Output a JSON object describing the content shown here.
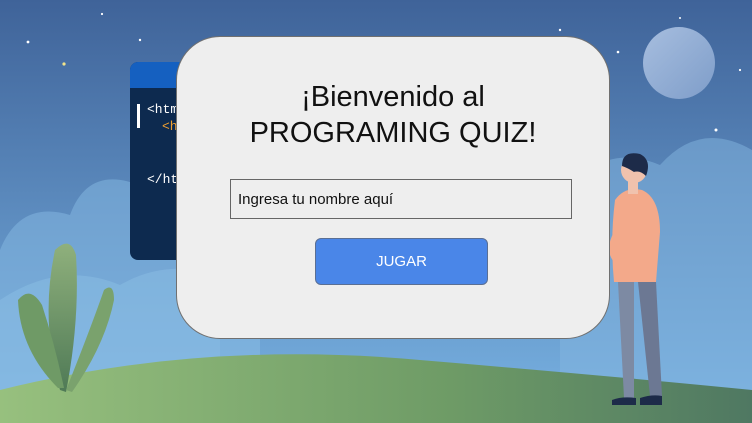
{
  "dialog": {
    "title_line1": "¡Bienvenido al",
    "title_line2": "PROGRAMING QUIZ!"
  },
  "name_input": {
    "placeholder": "Ingresa tu nombre aquí",
    "value": ""
  },
  "play_button": {
    "label": "JUGAR"
  },
  "code_panel": {
    "lines": [
      "<htm",
      "<h",
      "</ht"
    ]
  },
  "colors": {
    "sky_top": "#3f6399",
    "sky_bottom": "#79b3e3",
    "hill": "#7fab6c",
    "dialog_bg": "#eeeeee",
    "button_bg": "#4a86e8",
    "code_panel_bg": "#0d2a4f",
    "code_tag_orange": "#f0a030"
  },
  "illustration": {
    "icons": [
      "moon",
      "stars",
      "clouds",
      "plant",
      "person",
      "code-editor"
    ]
  }
}
